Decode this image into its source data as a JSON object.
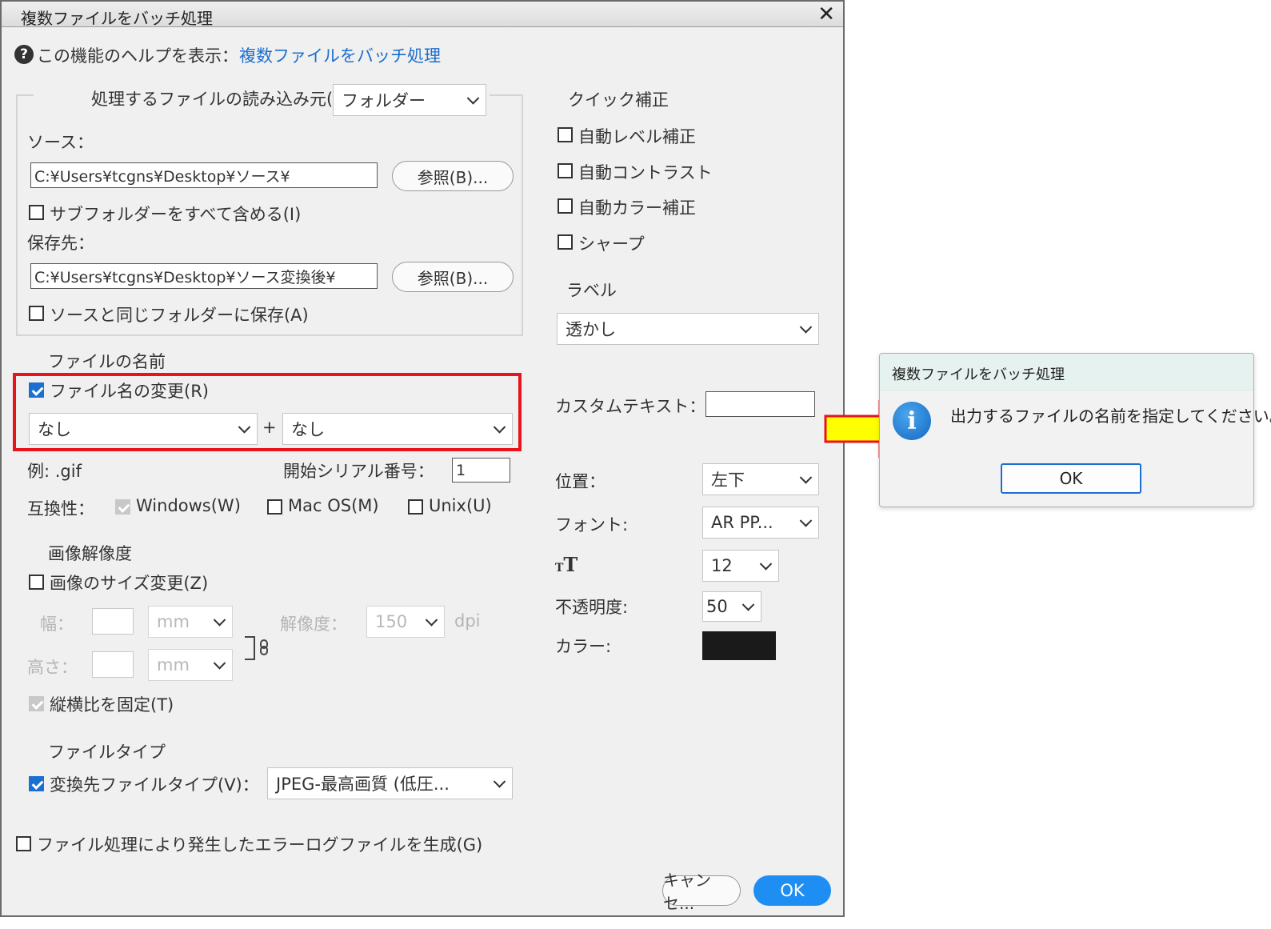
{
  "dialog": {
    "title": "複数ファイルをバッチ処理",
    "help_label": "この機能のヘルプを表示：",
    "help_link": "複数ファイルをバッチ処理",
    "source_group": {
      "load_from_label": "処理するファイルの読み込み元(P)：",
      "load_from_value": "フォルダー",
      "source_label": "ソース：",
      "source_path": "C:¥Users¥tcgns¥Desktop¥ソース¥",
      "browse_label": "参照(B)...",
      "include_subfolders_label": "サブフォルダーをすべて含める(I)",
      "include_subfolders_checked": false,
      "dest_label": "保存先：",
      "dest_path": "C:¥Users¥tcgns¥Desktop¥ソース変換後¥",
      "browse2_label": "参照(B)...",
      "same_folder_label": "ソースと同じフォルダーに保存(A)",
      "same_folder_checked": false
    },
    "file_name": {
      "section_label": "ファイルの名前",
      "rename_label": "ファイル名の変更(R)",
      "rename_checked": true,
      "part1": "なし",
      "plus": "+",
      "part2": "なし",
      "example_label": "例: .gif",
      "serial_label": "開始シリアル番号：",
      "serial_value": "1",
      "compat_label": "互換性：",
      "windows_label": "Windows(W)",
      "mac_label": "Mac OS(M)",
      "unix_label": "Unix(U)"
    },
    "image_size": {
      "section_label": "画像解像度",
      "resize_label": "画像のサイズ変更(Z)",
      "resize_checked": false,
      "width_label": "幅：",
      "height_label": "高さ：",
      "unit1": "mm",
      "unit2": "mm",
      "resolution_label": "解像度：",
      "resolution_value": "150",
      "dpi_label": "dpi",
      "ratio_label": "縦横比を固定(T)",
      "ratio_checked": true
    },
    "file_type": {
      "section_label": "ファイルタイプ",
      "convert_label": "変換先ファイルタイプ(V)：",
      "convert_checked": true,
      "convert_value": "JPEG-最高画質 (低圧..."
    },
    "error_log_label": "ファイル処理により発生したエラーログファイルを生成(G)",
    "error_log_checked": false,
    "quick_fix": {
      "section_label": "クイック補正",
      "auto_level": "自動レベル補正",
      "auto_contrast": "自動コントラスト",
      "auto_color": "自動カラー補正",
      "sharpen": "シャープ"
    },
    "label": {
      "section_label": "ラベル",
      "value": "透かし",
      "custom_text_label": "カスタムテキスト：",
      "custom_text_value": "",
      "position_label": "位置：",
      "position_value": "左下",
      "font_label": "フォント:",
      "font_value": "AR PP...",
      "size_value": "12",
      "opacity_label": "不透明度:",
      "opacity_value": "50",
      "color_label": "カラー:",
      "color_value": "#1a1a1a"
    },
    "cancel_label": "キャンセ...",
    "ok_label": "OK"
  },
  "message_box": {
    "title": "複数ファイルをバッチ処理",
    "message": "出力するファイルの名前を指定してください。",
    "ok_label": "OK",
    "icon": "info-icon"
  },
  "colors": {
    "highlight": "#e8131b",
    "accent": "#1f8ef3",
    "arrow_fill": "#ffff00"
  }
}
